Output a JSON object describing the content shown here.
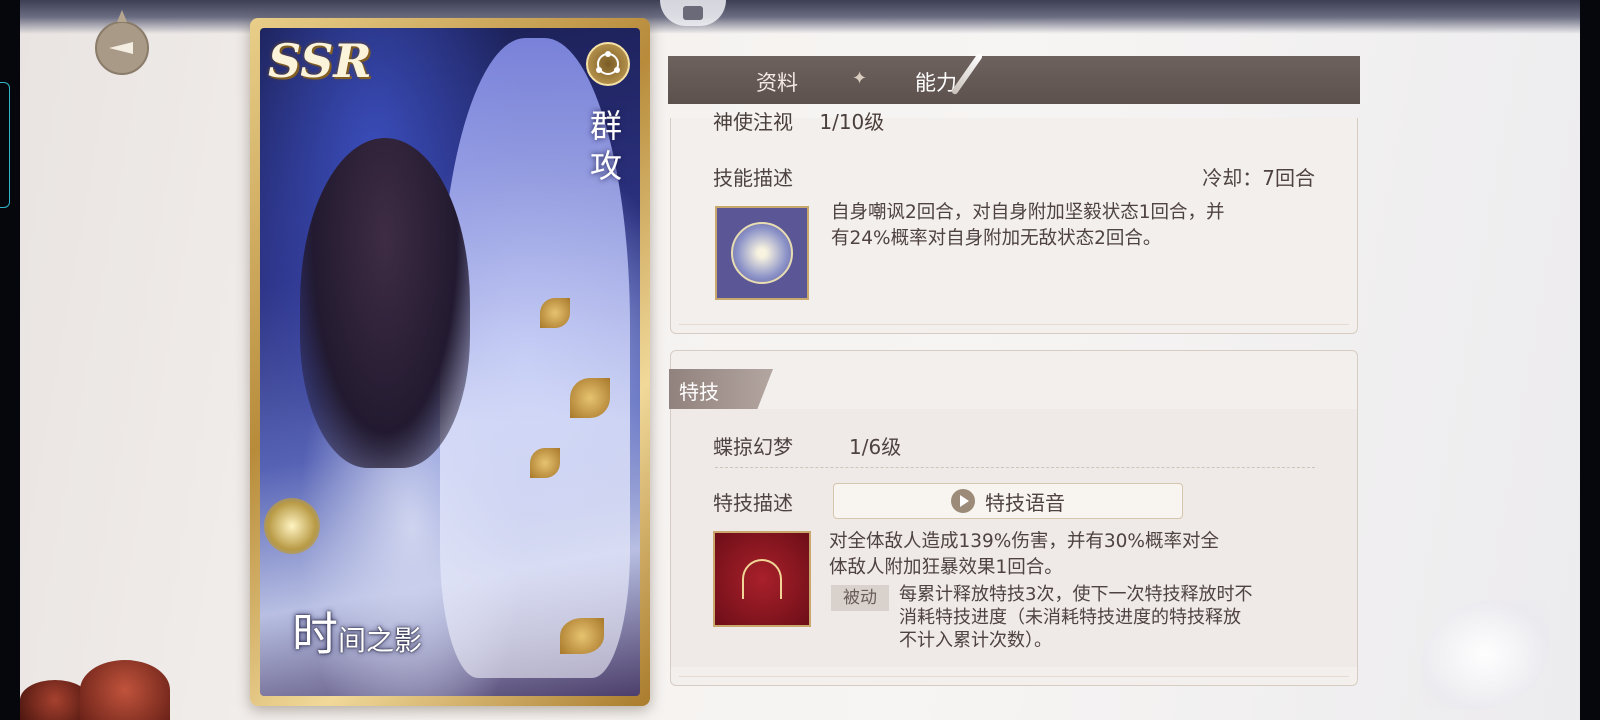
{
  "card": {
    "rarity": "SSR",
    "attack_type": "群攻",
    "name_first": "时",
    "name_rest": "间之影"
  },
  "tabs": [
    {
      "label": "资料",
      "active": false
    },
    {
      "label": "能力",
      "active": true
    }
  ],
  "tab_separator": "✦",
  "skill": {
    "cut_name": "神使注视",
    "cut_level": "1/10级",
    "desc_label": "技能描述",
    "cooldown": "冷却：7回合",
    "description_line1": "自身嘲讽2回合，对自身附加坚毅状态1回合，并",
    "description_line2": "有24%概率对自身附加无敌状态2回合。"
  },
  "ultimate": {
    "section_label": "特技",
    "name": "蝶掠幻梦",
    "level": "1/6级",
    "desc_label": "特技描述",
    "voice_button": "特技语音",
    "description_line1": "对全体敌人造成139%伤害，并有30%概率对全",
    "description_line2": "体敌人附加狂暴效果1回合。",
    "passive_tag": "被动",
    "passive_line1": "每累计释放特技3次，使下一次特技释放时不",
    "passive_line2": "消耗特技进度（未消耗特技进度的特技释放",
    "passive_line3": "不计入累计次数）。"
  },
  "colors": {
    "tab_bar": "#5d514e",
    "panel_bg": "#f3efec",
    "text": "#4e4340",
    "card_gold": "#b78b3a"
  }
}
